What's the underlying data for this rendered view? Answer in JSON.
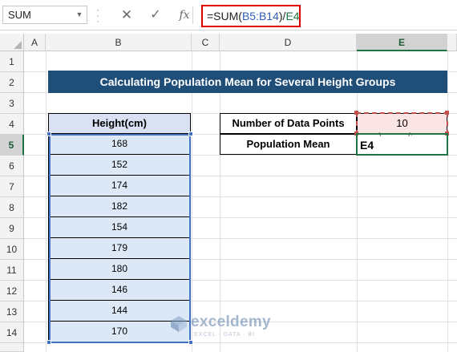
{
  "formula_bar": {
    "name_box": "SUM",
    "cancel_icon": "✕",
    "enter_icon": "✓",
    "fx_label": "fx",
    "formula_prefix": "=SUM(",
    "formula_range": "B5:B14",
    "formula_mid": ")/",
    "formula_ref": "E4"
  },
  "columns": [
    "A",
    "B",
    "C",
    "D",
    "E"
  ],
  "rows": [
    "1",
    "2",
    "3",
    "4",
    "5",
    "6",
    "7",
    "8",
    "9",
    "10",
    "11",
    "12",
    "13",
    "14"
  ],
  "sheet": {
    "title": "Calculating Population Mean for Several Height Groups",
    "height_header": "Height(cm)",
    "heights": [
      "168",
      "152",
      "174",
      "182",
      "154",
      "179",
      "180",
      "146",
      "144",
      "170"
    ],
    "label_data_points": "Number of Data Points",
    "value_data_points": "10",
    "label_population_mean": "Population Mean",
    "editing_text": "E4"
  },
  "watermark": {
    "name": "exceldemy",
    "tagline": "EXCEL · DATA · BI"
  },
  "colors": {
    "title_fill": "#1f4e79",
    "header_fill": "#d9e1f2",
    "data_fill": "#dde8f7",
    "data_points_fill": "#fbe4e4",
    "formula_highlight": "#e00000",
    "active_cell": "#217346"
  }
}
